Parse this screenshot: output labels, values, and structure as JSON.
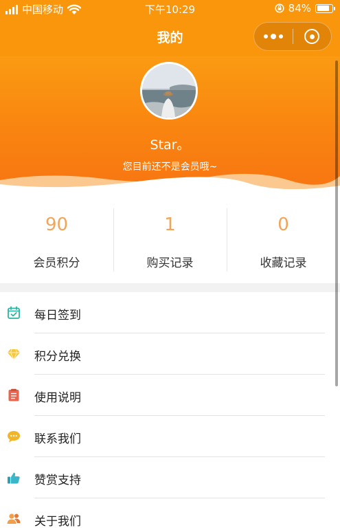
{
  "status_bar": {
    "carrier": "中国移动",
    "time": "下午10:29",
    "battery_percent": "84%",
    "battery_level": 0.84
  },
  "nav": {
    "title": "我的"
  },
  "profile": {
    "username": "Star。",
    "member_tip": "您目前还不是会员哦~"
  },
  "stats": [
    {
      "value": "90",
      "label": "会员积分"
    },
    {
      "value": "1",
      "label": "购买记录"
    },
    {
      "value": "0",
      "label": "收藏记录"
    }
  ],
  "menu": [
    {
      "label": "每日签到",
      "icon": "calendar-check-icon",
      "color": "#2bb3a3"
    },
    {
      "label": "积分兑换",
      "icon": "diamond-icon",
      "color": "#f6c63c"
    },
    {
      "label": "使用说明",
      "icon": "document-icon",
      "color": "#e8664f"
    },
    {
      "label": "联系我们",
      "icon": "chat-bubble-icon",
      "color": "#f2b529"
    },
    {
      "label": "赞赏支持",
      "icon": "thumbs-up-icon",
      "color": "#3bb6c9"
    },
    {
      "label": "关于我们",
      "icon": "users-icon",
      "color": "#f0a04a"
    }
  ],
  "colors": {
    "brand_orange": "#f9960b",
    "stat_number": "#f0a65a"
  }
}
